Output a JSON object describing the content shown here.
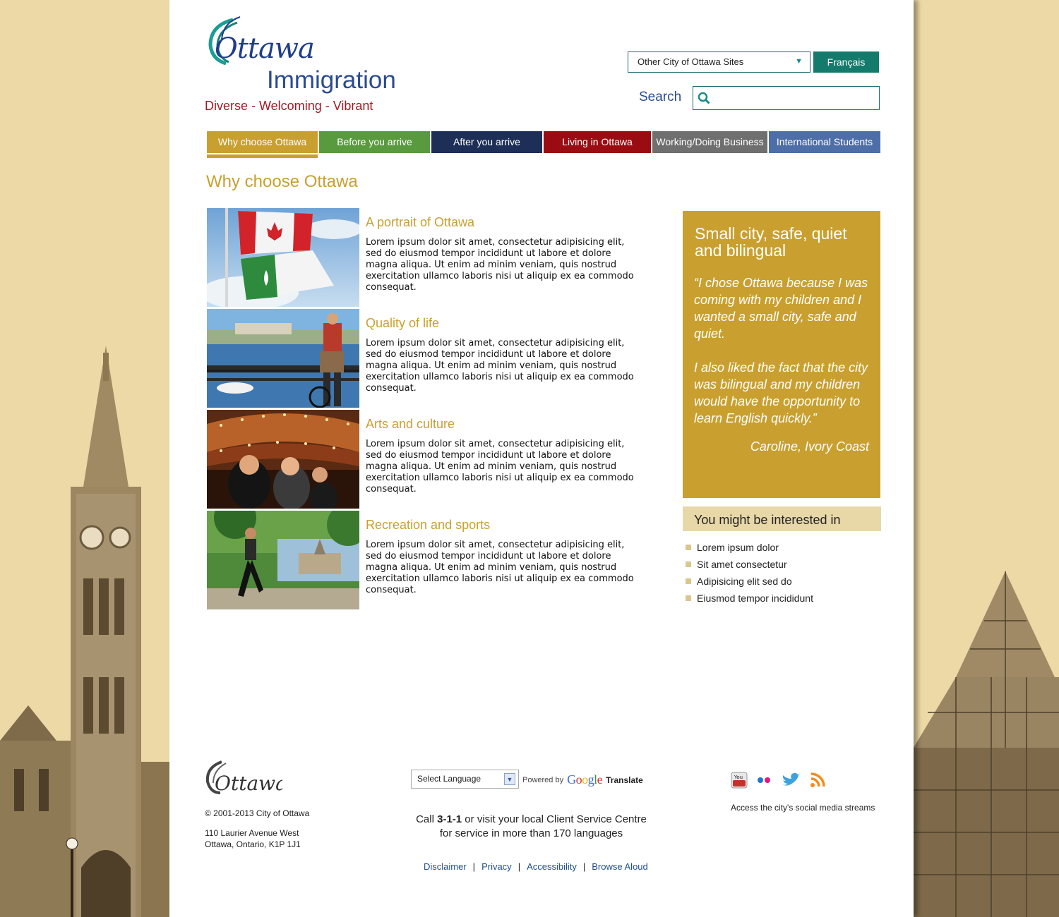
{
  "header": {
    "logo_word": "Ottawa",
    "logo_sub": "Immigration",
    "tagline": "Diverse - Welcoming - Vibrant",
    "sites_select": "Other City of Ottawa Sites",
    "lang_button": "Français",
    "search_label": "Search",
    "search_value": ""
  },
  "nav": [
    {
      "label": "Why choose Ottawa",
      "color": "#c9a02f"
    },
    {
      "label": "Before you arrive",
      "color": "#5a9a3f"
    },
    {
      "label": "After you arrive",
      "color": "#1e2f57"
    },
    {
      "label": "Living in Ottawa",
      "color": "#9b0c12"
    },
    {
      "label": "Working/Doing Business",
      "color": "#6f6f6f"
    },
    {
      "label": "International Students",
      "color": "#4e6ea8"
    }
  ],
  "main": {
    "title": "Why choose Ottawa",
    "features": [
      {
        "title": "A portrait of Ottawa",
        "text": "Lorem ipsum dolor sit amet, consectetur adipisicing elit, sed do eiusmod tempor incididunt ut labore et dolore magna aliqua. Ut enim ad minim veniam, quis nostrud exercitation ullamco laboris nisi ut aliquip ex ea commodo consequat."
      },
      {
        "title": "Quality of life",
        "text": "Lorem ipsum dolor sit amet, consectetur adipisicing elit, sed do eiusmod tempor incididunt ut labore et dolore magna aliqua. Ut enim ad minim veniam, quis nostrud exercitation ullamco laboris nisi ut aliquip ex ea commodo consequat."
      },
      {
        "title": "Arts and culture",
        "text": "Lorem ipsum dolor sit amet, consectetur adipisicing elit, sed do eiusmod tempor incididunt ut labore et dolore magna aliqua. Ut enim ad minim veniam, quis nostrud exercitation ullamco laboris nisi ut aliquip ex ea commodo consequat."
      },
      {
        "title": "Recreation and sports",
        "text": "Lorem ipsum dolor sit amet, consectetur adipisicing elit, sed do eiusmod tempor incididunt ut labore et dolore magna aliqua. Ut enim ad minim veniam, quis nostrud exercitation ullamco laboris nisi ut aliquip ex ea commodo consequat."
      }
    ]
  },
  "sidebar": {
    "quote_heading": "Small city, safe, quiet and bilingual",
    "quote_text": "“I chose Ottawa because I was coming with my children and I wanted a small city, safe and quiet.\n\nI also liked the fact that the city was bilingual and my children would have the opportunity to learn English quickly.”",
    "quote_author": "Caroline, Ivory Coast",
    "interested_heading": "You might be interested in",
    "links": [
      "Lorem ipsum dolor",
      "Sit amet consectetur",
      "Adipisicing elit sed do",
      "Eiusmod tempor incididunt"
    ]
  },
  "footer": {
    "copyright": "© 2001-2013 City of Ottawa",
    "address_line1": "110 Laurier Avenue West",
    "address_line2": "Ottawa, Ontario, K1P 1J1",
    "language_select": "Select Language",
    "powered_by": "Powered by",
    "google": "Google",
    "translate": "Translate",
    "call_prefix": "Call ",
    "call_number": "3-1-1",
    "call_suffix": " or visit your local Client Service Centre",
    "call_line2": "for service in more than 170 languages",
    "links": [
      "Disclaimer",
      "Privacy",
      "Accessibility",
      "Browse Aloud"
    ],
    "social_caption": "Access the city's social media streams",
    "social_icons": [
      "youtube-icon",
      "flickr-icon",
      "twitter-icon",
      "rss-icon"
    ]
  }
}
